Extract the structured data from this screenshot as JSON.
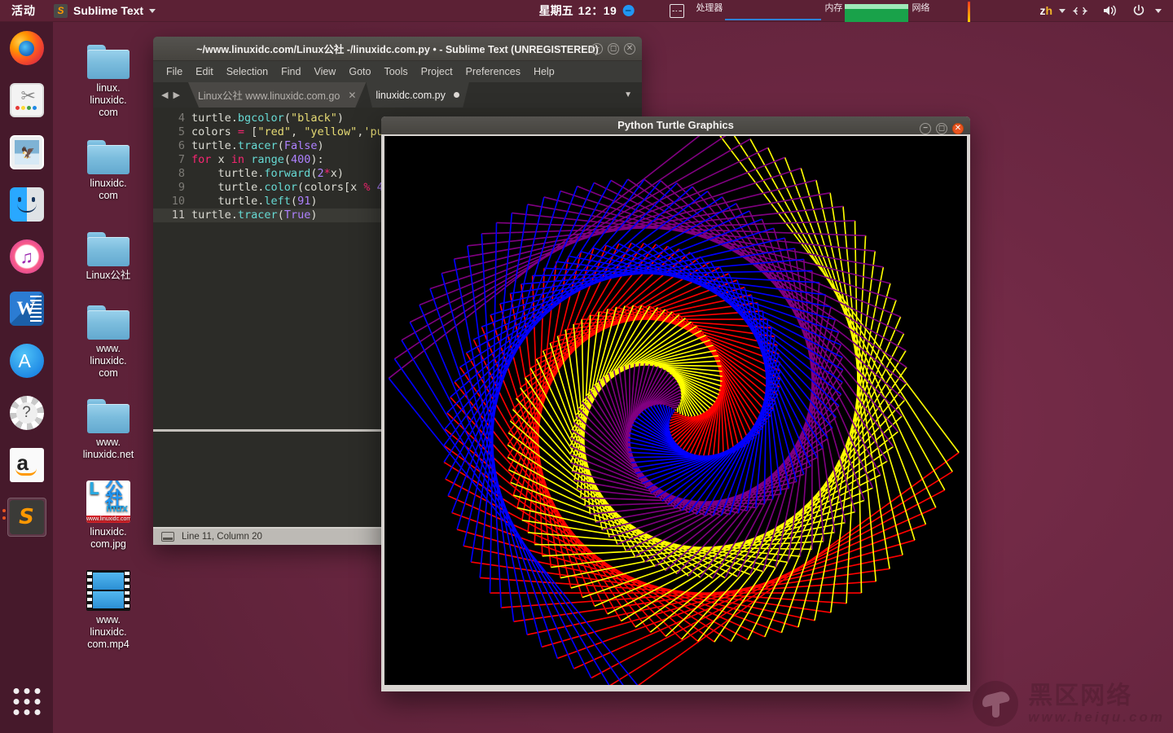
{
  "panel": {
    "activities": "活动",
    "app_icon": "sublime-text-icon",
    "app_name": "Sublime Text",
    "clock_day": "星期五",
    "clock_time": "12：19",
    "message_icon": "message-indicator-icon",
    "sysmon_icon": "system-monitor-icon",
    "cpu_label": "处理器",
    "mem_label": "内存",
    "net_label": "网络",
    "language": "zh",
    "lang_z": "z",
    "lang_h": "h",
    "network_icon": "network-icon",
    "volume_icon": "volume-icon",
    "power_icon": "power-icon",
    "menu_caret_icon": "chevron-down-icon"
  },
  "dock": {
    "items": [
      {
        "name": "firefox",
        "label": "Firefox"
      },
      {
        "name": "screenshot",
        "label": "Screenshot"
      },
      {
        "name": "mail",
        "label": "Mail"
      },
      {
        "name": "finder",
        "label": "Files"
      },
      {
        "name": "music",
        "label": "Music"
      },
      {
        "name": "word",
        "label": "Word"
      },
      {
        "name": "appstore",
        "label": "App Store"
      },
      {
        "name": "help",
        "label": "Help"
      },
      {
        "name": "amazon",
        "label": "Amazon"
      },
      {
        "name": "sublime",
        "label": "Sublime Text"
      }
    ],
    "show_apps_label": "Show Applications"
  },
  "desktop_icons": [
    {
      "type": "folder",
      "label": "linux.\nlinuxidc.\ncom"
    },
    {
      "type": "folder",
      "label": "linuxidc.\ncom"
    },
    {
      "type": "folder",
      "label": "Linux公社"
    },
    {
      "type": "folder",
      "label": "www.\nlinuxidc.\ncom"
    },
    {
      "type": "folder",
      "label": "www.\nlinuxidc.net"
    },
    {
      "type": "image",
      "label": "linuxidc.\ncom.jpg"
    },
    {
      "type": "video",
      "label": "www.\nlinuxidc.\ncom.mp4"
    }
  ],
  "jpg_icon": {
    "char_big": "L",
    "char_cn": "公社",
    "char_linux": "inux",
    "url": "www.linuxidc.com"
  },
  "sublime": {
    "title": "~/www.linuxidc.com/Linux公社 -/linuxidc.com.py • - Sublime Text (UNREGISTERED)",
    "window_buttons": {
      "minimize": "−",
      "maximize": "◻",
      "close": "✕"
    },
    "menu": [
      "File",
      "Edit",
      "Selection",
      "Find",
      "View",
      "Goto",
      "Tools",
      "Project",
      "Preferences",
      "Help"
    ],
    "tabs": [
      {
        "label": "Linux公社 www.linuxidc.com.go",
        "active": false,
        "close": "✕"
      },
      {
        "label": "linuxidc.com.py",
        "active": true,
        "modified": true
      }
    ],
    "tab_menu_caret": "▼",
    "code_lines": [
      {
        "number": "4",
        "current": false,
        "tokens": [
          {
            "t": "turtle.",
            "c": "obj"
          },
          {
            "t": "bgcolor",
            "c": "fn"
          },
          {
            "t": "(",
            "c": "var"
          },
          {
            "t": "\"black\"",
            "c": "str"
          },
          {
            "t": ")",
            "c": "var"
          }
        ]
      },
      {
        "number": "5",
        "current": false,
        "tokens": [
          {
            "t": "colors ",
            "c": "var"
          },
          {
            "t": "=",
            "c": "op"
          },
          {
            "t": " [",
            "c": "var"
          },
          {
            "t": "\"red\"",
            "c": "str"
          },
          {
            "t": ", ",
            "c": "var"
          },
          {
            "t": "\"yellow\"",
            "c": "str"
          },
          {
            "t": ",",
            "c": "var"
          },
          {
            "t": "'pu",
            "c": "str"
          }
        ]
      },
      {
        "number": "6",
        "current": false,
        "tokens": [
          {
            "t": "turtle.",
            "c": "obj"
          },
          {
            "t": "tracer",
            "c": "fn"
          },
          {
            "t": "(",
            "c": "var"
          },
          {
            "t": "False",
            "c": "const"
          },
          {
            "t": ")",
            "c": "var"
          }
        ]
      },
      {
        "number": "7",
        "current": false,
        "tokens": [
          {
            "t": "for",
            "c": "kw"
          },
          {
            "t": " x ",
            "c": "var"
          },
          {
            "t": "in",
            "c": "kw"
          },
          {
            "t": " ",
            "c": "var"
          },
          {
            "t": "range",
            "c": "fn"
          },
          {
            "t": "(",
            "c": "var"
          },
          {
            "t": "400",
            "c": "num"
          },
          {
            "t": "):",
            "c": "var"
          }
        ]
      },
      {
        "number": "8",
        "current": false,
        "tokens": [
          {
            "t": "    turtle.",
            "c": "obj"
          },
          {
            "t": "forward",
            "c": "fn"
          },
          {
            "t": "(",
            "c": "var"
          },
          {
            "t": "2",
            "c": "num"
          },
          {
            "t": "*",
            "c": "op"
          },
          {
            "t": "x)",
            "c": "var"
          }
        ]
      },
      {
        "number": "9",
        "current": false,
        "tokens": [
          {
            "t": "    turtle.",
            "c": "obj"
          },
          {
            "t": "color",
            "c": "fn"
          },
          {
            "t": "(colors[x ",
            "c": "var"
          },
          {
            "t": "%",
            "c": "op"
          },
          {
            "t": " 4",
            "c": "num"
          }
        ]
      },
      {
        "number": "10",
        "current": false,
        "tokens": [
          {
            "t": "    turtle.",
            "c": "obj"
          },
          {
            "t": "left",
            "c": "fn"
          },
          {
            "t": "(",
            "c": "var"
          },
          {
            "t": "91",
            "c": "num"
          },
          {
            "t": ")",
            "c": "var"
          }
        ]
      },
      {
        "number": "11",
        "current": true,
        "tokens": [
          {
            "t": "turtle.",
            "c": "obj"
          },
          {
            "t": "tracer",
            "c": "fn"
          },
          {
            "t": "(",
            "c": "var"
          },
          {
            "t": "True",
            "c": "const"
          },
          {
            "t": ")",
            "c": "var"
          }
        ]
      }
    ],
    "status": "Line 11, Column 20",
    "status_icon": "layout-icon"
  },
  "turtle": {
    "title": "Python Turtle Graphics",
    "window_buttons": {
      "minimize": "−",
      "maximize": "◻",
      "close": "✕"
    },
    "background": "#000000",
    "colors": [
      "#ff0000",
      "#ffff00",
      "#800080",
      "#0000ff"
    ],
    "color_names": [
      "red",
      "yellow",
      "purple",
      "blue"
    ],
    "steps": 400,
    "turn_angle": 91,
    "step_scale": 2
  },
  "watermark": {
    "logo": "mushroom-logo-icon",
    "text_cn": "黑区网络",
    "text_en": "www.heiqu.com"
  }
}
